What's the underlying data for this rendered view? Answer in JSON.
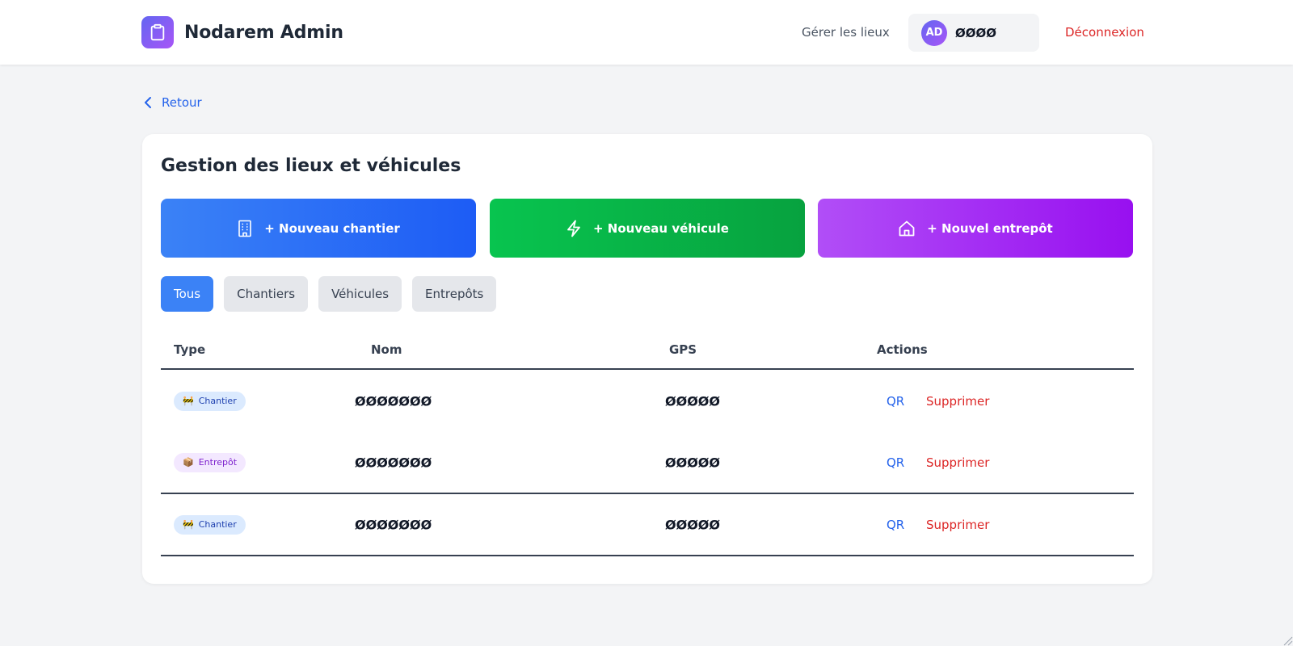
{
  "header": {
    "brand_title": "Nodarem Admin",
    "brand_icon": "clipboard-icon",
    "nav_link": "Gérer les lieux",
    "user": {
      "initials": "AD",
      "name": "ØØØØ"
    },
    "logout_label": "Déconnexion"
  },
  "back_label": "Retour",
  "card": {
    "title": "Gestion des lieux et véhicules",
    "actions": [
      {
        "label": "+ Nouveau chantier",
        "icon": "building-icon",
        "color": "#3b82f6"
      },
      {
        "label": "+ Nouveau véhicule",
        "icon": "lightning-icon",
        "color": "#08c44f"
      },
      {
        "label": "+ Nouvel entrepôt",
        "icon": "home-icon",
        "color": "#a855f7"
      }
    ],
    "filters": [
      {
        "label": "Tous",
        "active": true
      },
      {
        "label": "Chantiers",
        "active": false
      },
      {
        "label": "Véhicules",
        "active": false
      },
      {
        "label": "Entrepôts",
        "active": false
      }
    ]
  },
  "table": {
    "columns": [
      "Type",
      "Nom",
      "GPS",
      "Actions"
    ],
    "rows": [
      {
        "type": "Chantier",
        "type_icon": "🚧",
        "name": "ØØØØØØØ",
        "gps": "ØØØØØ",
        "qr": "QR",
        "delete": "Supprimer"
      },
      {
        "type": "Entrepôt",
        "type_icon": "📦",
        "name": "ØØØØØØØ",
        "gps": "ØØØØØ",
        "qr": "QR",
        "delete": "Supprimer"
      },
      {
        "type": "Chantier",
        "type_icon": "🚧",
        "name": "ØØØØØØØ",
        "gps": "ØØØØØ",
        "qr": "QR",
        "delete": "Supprimer"
      }
    ]
  },
  "colors": {
    "primary": "#3b82f6",
    "success": "#08c44f",
    "purple": "#a855f7",
    "danger": "#dc2626",
    "background": "#f3f4f6"
  }
}
